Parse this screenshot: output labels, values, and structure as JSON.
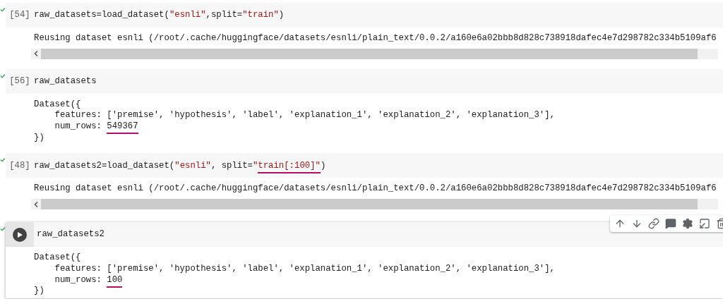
{
  "cells": [
    {
      "count": "[54]",
      "selected": false,
      "code": [
        {
          "kind": "plain",
          "text": "raw_datasets=load_dataset(",
          "underlined": false
        },
        {
          "kind": "string",
          "text": "\"esnli\"",
          "underlined": false
        },
        {
          "kind": "plain",
          "text": ",split=",
          "underlined": false
        },
        {
          "kind": "string",
          "text": "\"train\"",
          "underlined": false
        },
        {
          "kind": "plain",
          "text": ")",
          "underlined": false
        }
      ],
      "output": {
        "lines": [
          [
            {
              "text": "Reusing dataset esnli (/root/.cache/huggingface/datasets/esnli/plain_text/0.0.2/a160e6a02bbb8d828c738918dafec4e7d298782c334b5109af6"
            }
          ]
        ],
        "scrollbar": true
      }
    },
    {
      "count": "[56]",
      "selected": false,
      "code": [
        {
          "kind": "plain",
          "text": "raw_datasets",
          "underlined": false
        }
      ],
      "output": {
        "lines": [
          [
            {
              "text": "Dataset({"
            }
          ],
          [
            {
              "text": "    features: ['premise', 'hypothesis', 'label', 'explanation_1', 'explanation_2', 'explanation_3'],"
            }
          ],
          [
            {
              "text": "    num_rows: "
            },
            {
              "text": "549367",
              "kind": "annotated"
            }
          ],
          [
            {
              "text": "})"
            }
          ]
        ],
        "scrollbar": false
      }
    },
    {
      "count": "[48]",
      "selected": false,
      "code": [
        {
          "kind": "plain",
          "text": "raw_datasets2=load_dataset(",
          "underlined": false
        },
        {
          "kind": "string",
          "text": "\"esnli\"",
          "underlined": false
        },
        {
          "kind": "plain",
          "text": ", split=",
          "underlined": false
        },
        {
          "kind": "string",
          "text": "\"",
          "underlined": false
        },
        {
          "kind": "string",
          "text": "train[:100]\"",
          "underlined": true
        },
        {
          "kind": "plain",
          "text": ")",
          "underlined": false
        }
      ],
      "output": {
        "lines": [
          [
            {
              "text": "Reusing dataset esnli (/root/.cache/huggingface/datasets/esnli/plain_text/0.0.2/a160e6a02bbb8d828c738918dafec4e7d298782c334b5109af6"
            }
          ]
        ],
        "scrollbar": true
      }
    },
    {
      "selected": true,
      "code": [
        {
          "kind": "plain",
          "text": "raw_datasets2",
          "underlined": false
        }
      ],
      "output": {
        "lines": [
          [
            {
              "text": "Dataset({"
            }
          ],
          [
            {
              "text": "    features: ['premise', 'hypothesis', 'label', 'explanation_1', 'explanation_2', 'explanation_3'],"
            }
          ],
          [
            {
              "text": "    num_rows: "
            },
            {
              "text": "100",
              "kind": "annotated"
            }
          ],
          [
            {
              "text": "})"
            }
          ]
        ],
        "scrollbar": false
      }
    }
  ]
}
